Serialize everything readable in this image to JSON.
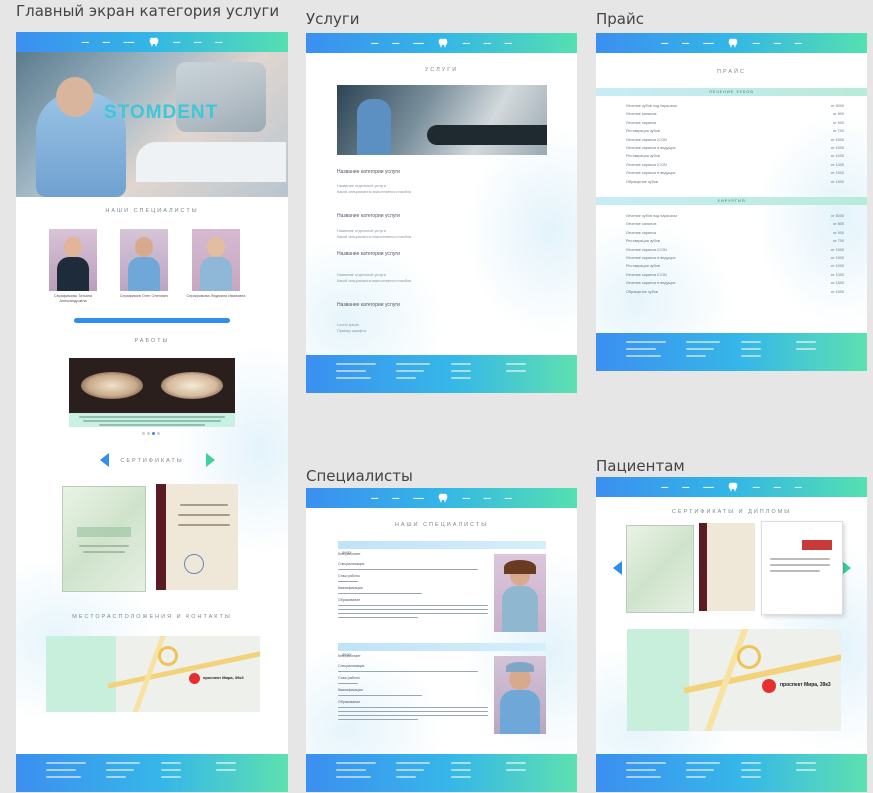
{
  "frames": {
    "home": {
      "title": "Главный экран категория услуги"
    },
    "services": {
      "title": "Услуги"
    },
    "price": {
      "title": "Прайс"
    },
    "specialists": {
      "title": "Специалисты"
    },
    "patients": {
      "title": "Пациентам"
    }
  },
  "home": {
    "hero_brand": "STOMDENT",
    "specialists_title": "НАШИ СПЕЦИАЛИСТЫ",
    "specialists": [
      {
        "name": "Серафимова Татьяна Александровна"
      },
      {
        "name": "Серафимов Олег Олегович"
      },
      {
        "name": "Серафимова Людмила Ивановна"
      }
    ],
    "works_title": "РАБОТЫ",
    "certificates_title": "СЕРТИФИКАТЫ",
    "location_title": "МЕСТОРАСПОЛОЖЕНИЯ И КОНТАКТЫ"
  },
  "services": {
    "section_title": "УСЛУГИ",
    "categories": [
      {
        "heading": "Название категории услуги",
        "items": [
          "Название отдельной услуги",
          "Какой специалисты выполняется пласбла"
        ]
      },
      {
        "heading": "Название категории услуги",
        "items": [
          "Название отдельной услуги",
          "Какой специалисты выполняется пласбла"
        ]
      },
      {
        "heading": "Название категории услуги",
        "items": [
          "Название отдельной услуги",
          "Какой специалисты выполняется пласбла"
        ]
      },
      {
        "heading": "Название категории услуги",
        "items": []
      }
    ],
    "lorem": [
      "Lorem ipsum",
      "Пример шрифта"
    ]
  },
  "price": {
    "section_title": "ПРАЙС",
    "groups": [
      {
        "band": "ЛЕЧЕНИЕ ЗУБОВ",
        "rows": [
          {
            "name": "Лечение зубов под наркозом",
            "price": "от 3000"
          },
          {
            "name": "Лечение каналов",
            "price": "от 800"
          },
          {
            "name": "Лечение кариеса",
            "price": "от 500"
          },
          {
            "name": "Реставрация зубов",
            "price": "от 700"
          },
          {
            "name": "Лечение кариеса ICON",
            "price": "от 1500"
          },
          {
            "name": "Лечение кариеса в ведущих",
            "price": "от 1500"
          },
          {
            "name": "Реставрация зубов",
            "price": "от 1000"
          },
          {
            "name": "Лечение кариеса ICON",
            "price": "от 1000"
          },
          {
            "name": "Лечение кариеса в ведущих",
            "price": "от 1500"
          },
          {
            "name": "Обращение зубов",
            "price": "от 1500"
          }
        ]
      },
      {
        "band": "ХИРУРГИЯ",
        "rows": [
          {
            "name": "Лечение зубов под наркозом",
            "price": "от 3000"
          },
          {
            "name": "Лечение каналов",
            "price": "от 800"
          },
          {
            "name": "Лечение кариеса",
            "price": "от 500"
          },
          {
            "name": "Реставрация зубов",
            "price": "от 700"
          },
          {
            "name": "Лечение кариеса ICON",
            "price": "от 1500"
          },
          {
            "name": "Лечение кариеса в ведущих",
            "price": "от 1500"
          },
          {
            "name": "Реставрация зубов",
            "price": "от 1000"
          },
          {
            "name": "Лечение кариеса ICON",
            "price": "от 1000"
          },
          {
            "name": "Лечение кариеса в ведущих",
            "price": "от 1500"
          },
          {
            "name": "Обращение зубов",
            "price": "от 1500"
          }
        ]
      }
    ]
  },
  "specialists": {
    "section_title": "НАШИ СПЕЦИАЛИСТЫ",
    "cards": [
      {
        "fio": "ФИО",
        "fields": [
          "Кем работает",
          "Специализация",
          "Стаж работы",
          "Квалификация",
          "Образование"
        ]
      },
      {
        "fio": "ФИО",
        "fields": [
          "Кем работает",
          "Специализация",
          "Стаж работы",
          "Квалификация",
          "Образование"
        ]
      }
    ]
  },
  "patients": {
    "section_title": "СЕРТИФИКАТЫ И ДИПЛОМЫ"
  },
  "map": {
    "address": "проспект Мира, 39к3"
  },
  "colors": {
    "nav_start": "#3b8ff0",
    "nav_end": "#55e0b0",
    "accent_blue": "#2f8fea",
    "accent_green": "#3fd19a"
  }
}
